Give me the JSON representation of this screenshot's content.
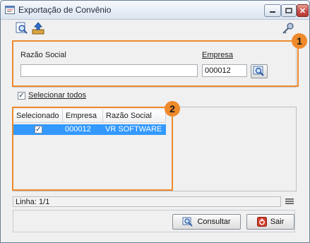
{
  "window": {
    "title": "Exportação de Convênio"
  },
  "form": {
    "razao_label": "Razão Social",
    "razao_value": "",
    "empresa_label": "Empresa",
    "empresa_value": "000012"
  },
  "markers": {
    "m1": "1",
    "m2": "2"
  },
  "select_all": {
    "label": "Selecionar todos",
    "checked": true
  },
  "table": {
    "columns": [
      "Selecionado",
      "Empresa",
      "Razão Social"
    ],
    "rows": [
      {
        "selecionado": true,
        "empresa": "000012",
        "razao_social": "VR SOFTWARE"
      }
    ]
  },
  "status": {
    "line": "Linha: 1/1"
  },
  "buttons": {
    "consultar": "Consultar",
    "sair": "Sair"
  },
  "colors": {
    "highlight": "#ee8a2b",
    "selection": "#3399ff"
  },
  "icons": [
    "app-icon",
    "minimize-icon",
    "maximize-icon",
    "close-icon",
    "search-document-icon",
    "export-icon",
    "key-icon",
    "search-icon",
    "exit-icon",
    "menu-icon"
  ]
}
